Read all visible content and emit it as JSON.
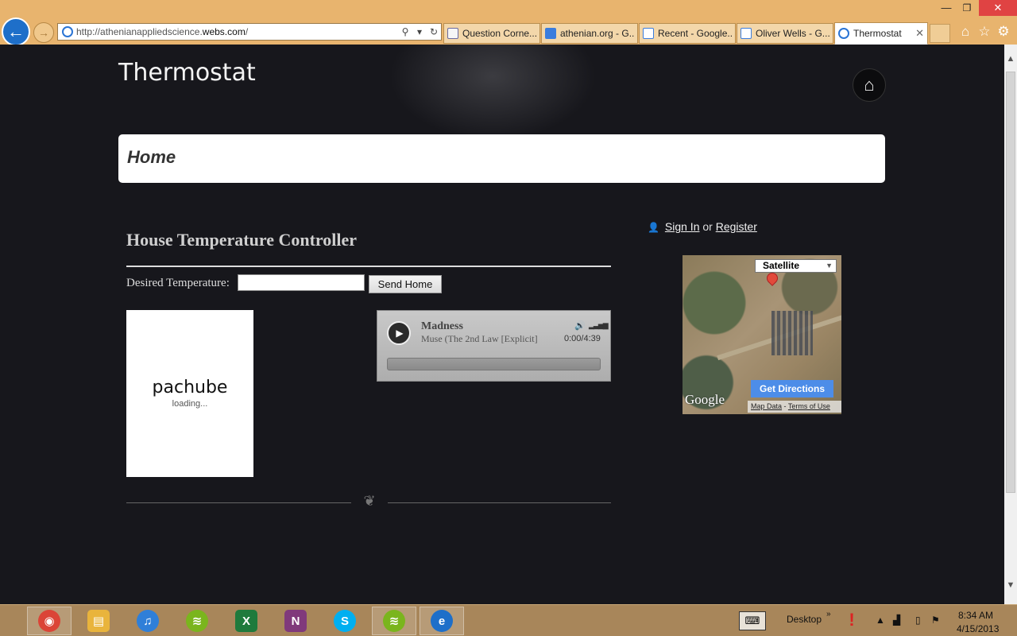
{
  "window": {
    "minimize_glyph": "—",
    "maximize_glyph": "❐",
    "close_glyph": "✕"
  },
  "browser": {
    "url_prefix": "http://athenianappliedscience.",
    "url_domain": "webs.com",
    "url_suffix": "/",
    "tabs": [
      {
        "label": "Question Corne...",
        "icon": "shield-favicon",
        "active": false
      },
      {
        "label": "athenian.org - G...",
        "icon": "google-favicon",
        "active": false
      },
      {
        "label": "Recent - Google...",
        "icon": "google-drive-favicon",
        "active": false
      },
      {
        "label": "Oliver Wells - G...",
        "icon": "google-drive-favicon",
        "active": false
      },
      {
        "label": "Thermostat",
        "icon": "ie-favicon",
        "active": true
      }
    ],
    "toolbar_icons": [
      "home-icon",
      "star-icon",
      "gear-icon"
    ]
  },
  "page": {
    "site_title": "Thermostat",
    "nav_current": "Home",
    "section_heading": "House Temperature Controller",
    "temp_label": "Desired Temperature:",
    "temp_value": "",
    "send_label": "Send Home",
    "pachube": {
      "logo": "pachube",
      "status": "loading..."
    },
    "player": {
      "title": "Madness",
      "artist": "Muse (The 2nd Law [Explicit]",
      "time": "0:00/4:39",
      "progress": 0
    },
    "auth": {
      "sign_in": "Sign In",
      "or": "or",
      "register": "Register"
    },
    "map": {
      "type": "Satellite",
      "directions": "Get Directions",
      "brand": "Google",
      "map_data": "Map Data",
      "separator": "-",
      "terms": "Terms of Use"
    }
  },
  "taskbar": {
    "apps": [
      {
        "name": "chrome",
        "color": "#db4437",
        "running": true
      },
      {
        "name": "file-explorer",
        "color": "#e9b43c",
        "running": false
      },
      {
        "name": "itunes",
        "color": "#2f7fd8",
        "running": false
      },
      {
        "name": "spotify",
        "color": "#7ab51d",
        "running": false
      },
      {
        "name": "excel",
        "color": "#1f7a3c",
        "running": false
      },
      {
        "name": "onenote",
        "color": "#80397b",
        "running": false
      },
      {
        "name": "skype",
        "color": "#00aff0",
        "running": false
      },
      {
        "name": "spotify",
        "color": "#7ab51d",
        "running": true
      },
      {
        "name": "internet-explorer",
        "color": "#1e6fc9",
        "running": true
      }
    ],
    "desktop_label": "Desktop",
    "time": "8:34 AM",
    "date": "4/15/2013"
  }
}
